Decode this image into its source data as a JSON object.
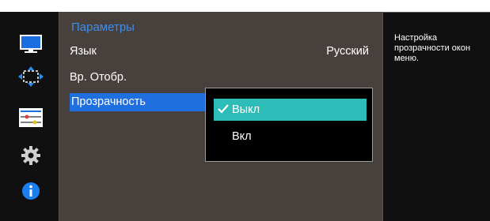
{
  "icons": [
    "monitor-icon",
    "move-arrows-icon",
    "menu-sliders-icon",
    "gear-icon",
    "info-icon"
  ],
  "menu": {
    "title": "Параметры",
    "items": [
      {
        "label": "Язык",
        "value": "Русский"
      },
      {
        "label": "Вр. Отобр."
      },
      {
        "label": "Прозрачность"
      }
    ]
  },
  "popup": {
    "options": [
      {
        "label": "Выкл",
        "selected": true
      },
      {
        "label": "Вкл",
        "selected": false
      }
    ]
  },
  "help": {
    "text": "Настройка прозрачности окон меню."
  },
  "colors": {
    "title": "#3b8ef0",
    "selected_row": "#1f6fe0",
    "popup_selected": "#2ebcb8",
    "panel_bg": "#47403d",
    "side_bg": "#101010"
  }
}
